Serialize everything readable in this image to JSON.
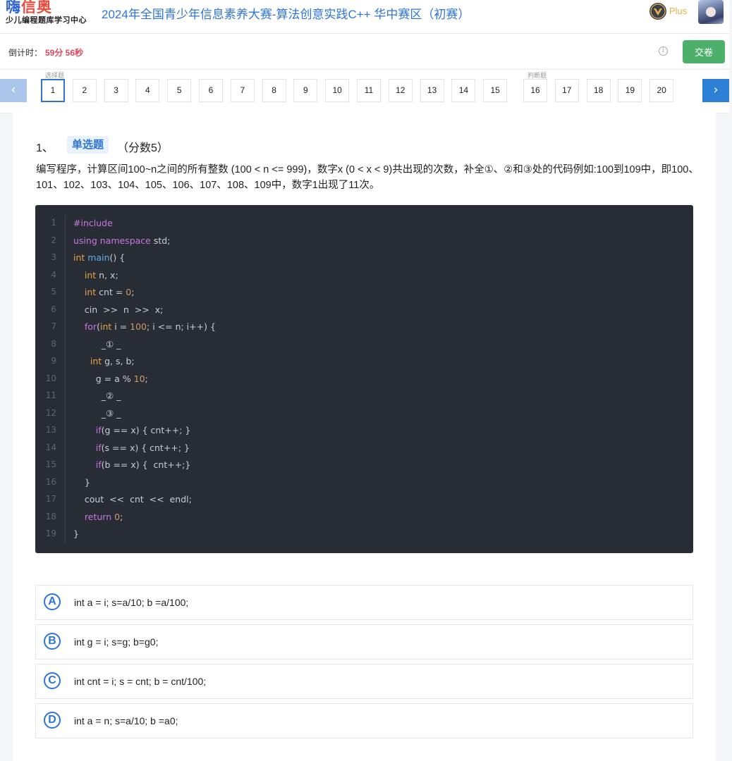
{
  "header": {
    "logo_main_part1": "嗨",
    "logo_main_part2": "信奥",
    "logo_sub": "少儿编程题库学习中心",
    "title": "2024年全国青少年信息素养大赛-算法创意实践C++ 华中赛区（初赛）",
    "vip_label": "Plus"
  },
  "countdown": {
    "label": "倒计时：",
    "value": "59分 56秒",
    "info_icon": "i",
    "submit_label": "交卷"
  },
  "nav": {
    "prev_icon": "‹",
    "next_icon": "›",
    "group_choice_label": "选择题",
    "group_judge_label": "判断题",
    "choice_questions": [
      "1",
      "2",
      "3",
      "4",
      "5",
      "6",
      "7",
      "8",
      "9",
      "10",
      "11",
      "12",
      "13",
      "14",
      "15"
    ],
    "judge_questions": [
      "16",
      "17",
      "18",
      "19",
      "20"
    ],
    "active": "1"
  },
  "question": {
    "number": "1、",
    "type": "单选题",
    "score": "（分数5）",
    "text": "编写程序，计算区间100~n之间的所有整数 (100 < n <= 999)，数字x (0 < x < 9)共出现的次数，补全①、②和③处的代码例如:100到109中，即100、101、102、103、104、105、106、107、108、109中，数字1出现了11次。"
  },
  "code_lines": [
    {
      "n": "1",
      "t": "#include"
    },
    {
      "n": "2",
      "t": "using namespace std;"
    },
    {
      "n": "3",
      "t": "int main() {"
    },
    {
      "n": "4",
      "t": "    int n, x;"
    },
    {
      "n": "5",
      "t": "    int cnt = 0;"
    },
    {
      "n": "6",
      "t": "    cin  >>  n  >>  x;"
    },
    {
      "n": "7",
      "t": "    for(int i = 100; i <= n; i++) {"
    },
    {
      "n": "8",
      "t": "          _① _"
    },
    {
      "n": "9",
      "t": "      int g, s, b;"
    },
    {
      "n": "10",
      "t": "        g = a % 10;"
    },
    {
      "n": "11",
      "t": "          _② _"
    },
    {
      "n": "12",
      "t": "          _③ _"
    },
    {
      "n": "13",
      "t": "        if(g == x) { cnt++; }"
    },
    {
      "n": "14",
      "t": "        if(s == x) { cnt++; }"
    },
    {
      "n": "15",
      "t": "        if(b == x) {  cnt++;}"
    },
    {
      "n": "16",
      "t": "    }"
    },
    {
      "n": "17",
      "t": "    cout  <<  cnt  <<  endl;"
    },
    {
      "n": "18",
      "t": "    return 0;"
    },
    {
      "n": "19",
      "t": "}"
    }
  ],
  "options": [
    {
      "letter": "A",
      "text": "int a = i; s=a/10; b =a/100;"
    },
    {
      "letter": "B",
      "text": "int g = i; s=g; b=g0;"
    },
    {
      "letter": "C",
      "text": "int cnt = i; s = cnt; b = cnt/100;"
    },
    {
      "letter": "D",
      "text": "int a = n; s=a/10; b =a0;"
    }
  ],
  "colors": {
    "accent_blue": "#2e74d6",
    "submit_green": "#4caf6a",
    "countdown_red": "#e0475e",
    "code_bg": "#282c34"
  }
}
